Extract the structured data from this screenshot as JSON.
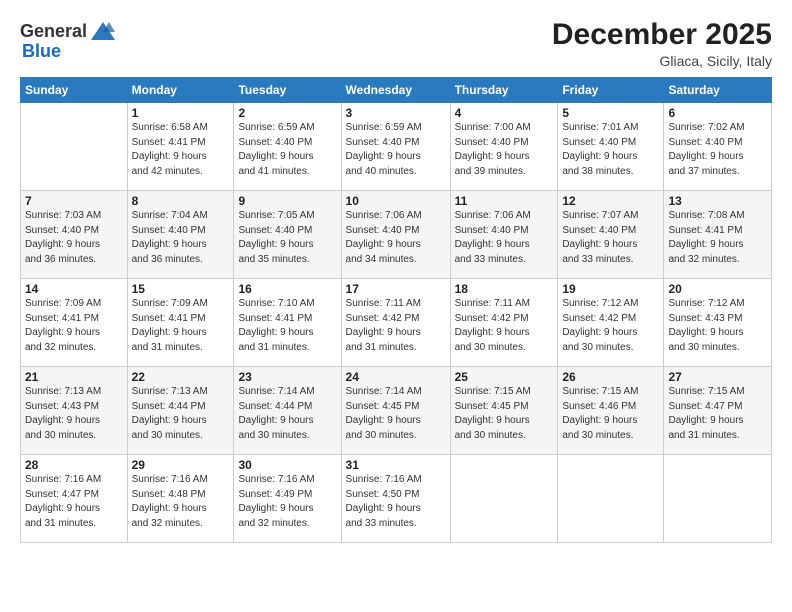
{
  "logo": {
    "general": "General",
    "blue": "Blue"
  },
  "header": {
    "month": "December 2025",
    "location": "Gliaca, Sicily, Italy"
  },
  "days_of_week": [
    "Sunday",
    "Monday",
    "Tuesday",
    "Wednesday",
    "Thursday",
    "Friday",
    "Saturday"
  ],
  "weeks": [
    [
      {
        "day": "",
        "info": ""
      },
      {
        "day": "1",
        "info": "Sunrise: 6:58 AM\nSunset: 4:41 PM\nDaylight: 9 hours\nand 42 minutes."
      },
      {
        "day": "2",
        "info": "Sunrise: 6:59 AM\nSunset: 4:40 PM\nDaylight: 9 hours\nand 41 minutes."
      },
      {
        "day": "3",
        "info": "Sunrise: 6:59 AM\nSunset: 4:40 PM\nDaylight: 9 hours\nand 40 minutes."
      },
      {
        "day": "4",
        "info": "Sunrise: 7:00 AM\nSunset: 4:40 PM\nDaylight: 9 hours\nand 39 minutes."
      },
      {
        "day": "5",
        "info": "Sunrise: 7:01 AM\nSunset: 4:40 PM\nDaylight: 9 hours\nand 38 minutes."
      },
      {
        "day": "6",
        "info": "Sunrise: 7:02 AM\nSunset: 4:40 PM\nDaylight: 9 hours\nand 37 minutes."
      }
    ],
    [
      {
        "day": "7",
        "info": "Sunrise: 7:03 AM\nSunset: 4:40 PM\nDaylight: 9 hours\nand 36 minutes."
      },
      {
        "day": "8",
        "info": "Sunrise: 7:04 AM\nSunset: 4:40 PM\nDaylight: 9 hours\nand 36 minutes."
      },
      {
        "day": "9",
        "info": "Sunrise: 7:05 AM\nSunset: 4:40 PM\nDaylight: 9 hours\nand 35 minutes."
      },
      {
        "day": "10",
        "info": "Sunrise: 7:06 AM\nSunset: 4:40 PM\nDaylight: 9 hours\nand 34 minutes."
      },
      {
        "day": "11",
        "info": "Sunrise: 7:06 AM\nSunset: 4:40 PM\nDaylight: 9 hours\nand 33 minutes."
      },
      {
        "day": "12",
        "info": "Sunrise: 7:07 AM\nSunset: 4:40 PM\nDaylight: 9 hours\nand 33 minutes."
      },
      {
        "day": "13",
        "info": "Sunrise: 7:08 AM\nSunset: 4:41 PM\nDaylight: 9 hours\nand 32 minutes."
      }
    ],
    [
      {
        "day": "14",
        "info": "Sunrise: 7:09 AM\nSunset: 4:41 PM\nDaylight: 9 hours\nand 32 minutes."
      },
      {
        "day": "15",
        "info": "Sunrise: 7:09 AM\nSunset: 4:41 PM\nDaylight: 9 hours\nand 31 minutes."
      },
      {
        "day": "16",
        "info": "Sunrise: 7:10 AM\nSunset: 4:41 PM\nDaylight: 9 hours\nand 31 minutes."
      },
      {
        "day": "17",
        "info": "Sunrise: 7:11 AM\nSunset: 4:42 PM\nDaylight: 9 hours\nand 31 minutes."
      },
      {
        "day": "18",
        "info": "Sunrise: 7:11 AM\nSunset: 4:42 PM\nDaylight: 9 hours\nand 30 minutes."
      },
      {
        "day": "19",
        "info": "Sunrise: 7:12 AM\nSunset: 4:42 PM\nDaylight: 9 hours\nand 30 minutes."
      },
      {
        "day": "20",
        "info": "Sunrise: 7:12 AM\nSunset: 4:43 PM\nDaylight: 9 hours\nand 30 minutes."
      }
    ],
    [
      {
        "day": "21",
        "info": "Sunrise: 7:13 AM\nSunset: 4:43 PM\nDaylight: 9 hours\nand 30 minutes."
      },
      {
        "day": "22",
        "info": "Sunrise: 7:13 AM\nSunset: 4:44 PM\nDaylight: 9 hours\nand 30 minutes."
      },
      {
        "day": "23",
        "info": "Sunrise: 7:14 AM\nSunset: 4:44 PM\nDaylight: 9 hours\nand 30 minutes."
      },
      {
        "day": "24",
        "info": "Sunrise: 7:14 AM\nSunset: 4:45 PM\nDaylight: 9 hours\nand 30 minutes."
      },
      {
        "day": "25",
        "info": "Sunrise: 7:15 AM\nSunset: 4:45 PM\nDaylight: 9 hours\nand 30 minutes."
      },
      {
        "day": "26",
        "info": "Sunrise: 7:15 AM\nSunset: 4:46 PM\nDaylight: 9 hours\nand 30 minutes."
      },
      {
        "day": "27",
        "info": "Sunrise: 7:15 AM\nSunset: 4:47 PM\nDaylight: 9 hours\nand 31 minutes."
      }
    ],
    [
      {
        "day": "28",
        "info": "Sunrise: 7:16 AM\nSunset: 4:47 PM\nDaylight: 9 hours\nand 31 minutes."
      },
      {
        "day": "29",
        "info": "Sunrise: 7:16 AM\nSunset: 4:48 PM\nDaylight: 9 hours\nand 32 minutes."
      },
      {
        "day": "30",
        "info": "Sunrise: 7:16 AM\nSunset: 4:49 PM\nDaylight: 9 hours\nand 32 minutes."
      },
      {
        "day": "31",
        "info": "Sunrise: 7:16 AM\nSunset: 4:50 PM\nDaylight: 9 hours\nand 33 minutes."
      },
      {
        "day": "",
        "info": ""
      },
      {
        "day": "",
        "info": ""
      },
      {
        "day": "",
        "info": ""
      }
    ]
  ]
}
